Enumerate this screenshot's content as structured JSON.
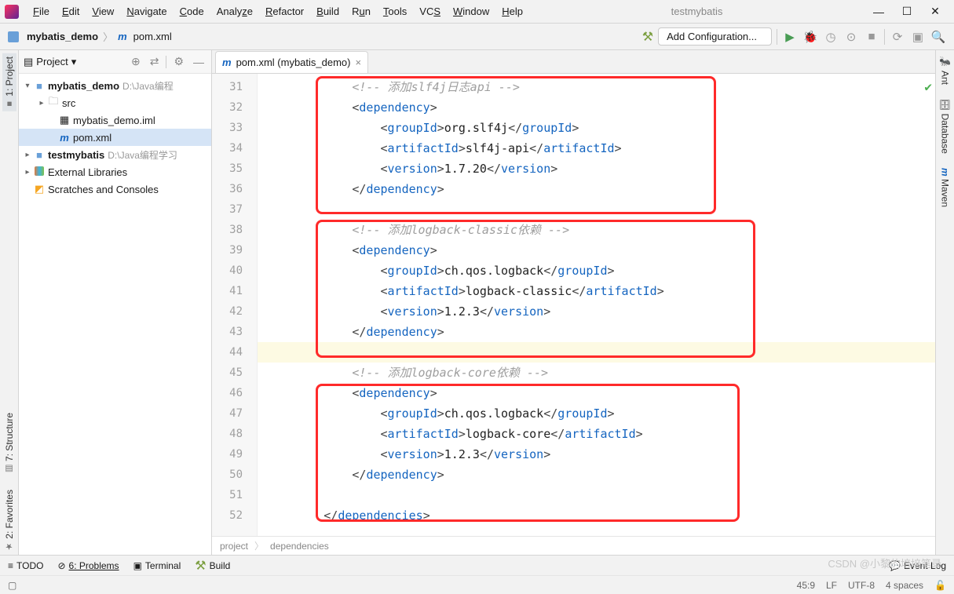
{
  "window": {
    "title": "testmybatis"
  },
  "menu": [
    "File",
    "Edit",
    "View",
    "Navigate",
    "Code",
    "Analyze",
    "Refactor",
    "Build",
    "Run",
    "Tools",
    "VCS",
    "Window",
    "Help"
  ],
  "breadcrumb": {
    "project": "mybatis_demo",
    "file": "pom.xml"
  },
  "toolbar": {
    "config": "Add Configuration..."
  },
  "sidebar": {
    "header": "Project",
    "tree": {
      "root": {
        "name": "mybatis_demo",
        "path": "D:\\Java编程"
      },
      "src": "src",
      "iml": "mybatis_demo.iml",
      "pom": "pom.xml",
      "other_proj": {
        "name": "testmybatis",
        "path": "D:\\Java编程学习"
      },
      "ext_lib": "External Libraries",
      "scratch": "Scratches and Consoles"
    }
  },
  "leftRail": {
    "project": "1: Project",
    "structure": "7: Structure",
    "favorites": "2: Favorites"
  },
  "rightRail": {
    "ant": "Ant",
    "database": "Database",
    "maven": "Maven"
  },
  "tab": {
    "label": "pom.xml (mybatis_demo)"
  },
  "gutter": {
    "start": 31,
    "end": 52
  },
  "code": {
    "c1": "<!-- 添加slf4j日志api -->",
    "dep_open": "dependency",
    "dep_close": "dependency",
    "gid": "groupId",
    "aid": "artifactId",
    "ver": "version",
    "slf4j_gid": "org.slf4j",
    "slf4j_aid": "slf4j-api",
    "slf4j_ver": "1.7.20",
    "c2": "<!-- 添加logback-classic依赖 -->",
    "lb_gid": "ch.qos.logback",
    "lbc_aid": "logback-classic",
    "lb_ver": "1.2.3",
    "c3": "<!-- 添加logback-core依赖 -->",
    "lbcore_aid": "logback-core",
    "deps_close": "dependencies"
  },
  "crumbs": {
    "a": "project",
    "b": "dependencies"
  },
  "bottom": {
    "todo": "TODO",
    "problems": "6: Problems",
    "terminal": "Terminal",
    "build": "Build",
    "eventlog": "Event Log"
  },
  "status": {
    "pos": "45:9",
    "le": "LF",
    "enc": "UTF-8",
    "indent": "4 spaces",
    "watermark": "CSDN @小黎的培培笔录"
  }
}
